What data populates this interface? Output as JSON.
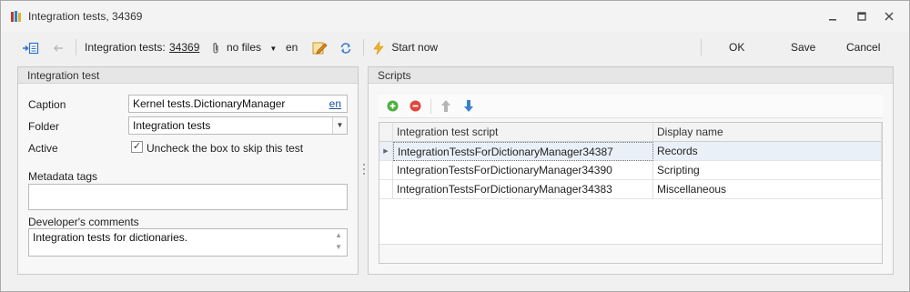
{
  "window": {
    "title": "Integration tests, 34369",
    "controls": [
      "minimize-icon",
      "restore-icon",
      "close-icon"
    ]
  },
  "toolbar": {
    "entity_label": "Integration tests:",
    "entity_number": "34369",
    "files_label": "no files",
    "language": "en",
    "start_label": "Start now",
    "ok_label": "OK",
    "save_label": "Save",
    "cancel_label": "Cancel"
  },
  "left_panel": {
    "header": "Integration test",
    "caption_label": "Caption",
    "caption_value": "Kernel tests.DictionaryManager",
    "caption_lang": "en",
    "folder_label": "Folder",
    "folder_value": "Integration tests",
    "active_label": "Active",
    "active_checkbox_text": "Uncheck the box to skip this test",
    "active_checked": true,
    "metadata_label": "Metadata tags",
    "metadata_value": "",
    "comments_label": "Developer's comments",
    "comments_value": "Integration tests for dictionaries."
  },
  "right_panel": {
    "header": "Scripts",
    "grid": {
      "columns": [
        "Integration test script",
        "Display name"
      ],
      "rows": [
        {
          "script": "IntegrationTestsForDictionaryManager34387",
          "display": "Records"
        },
        {
          "script": "IntegrationTestsForDictionaryManager34390",
          "display": "Scripting"
        },
        {
          "script": "IntegrationTestsForDictionaryManager34383",
          "display": "Miscellaneous"
        }
      ]
    }
  },
  "colors": {
    "add": "#4caf3e",
    "remove": "#e0463f",
    "move_up": "#b5b5b5",
    "move_down": "#3d7fd1",
    "start": "#f2b51c",
    "link": "#1a4fa0"
  }
}
